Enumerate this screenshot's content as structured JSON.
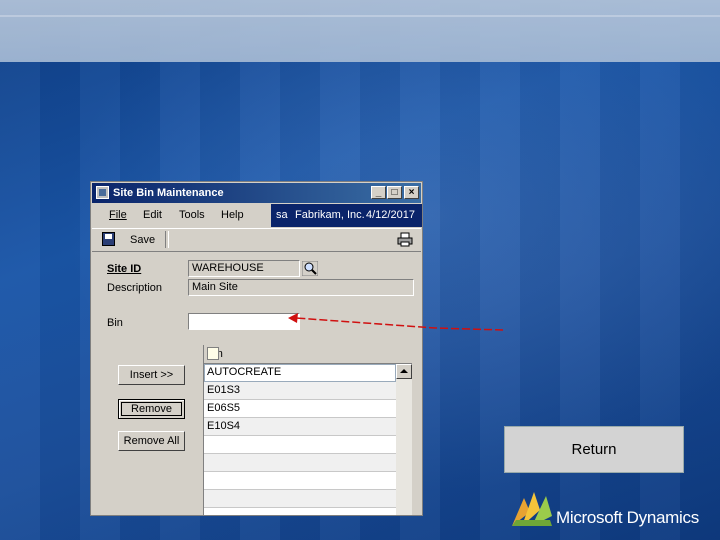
{
  "window": {
    "title": "Site Bin Maintenance",
    "controls": {
      "minimize": "_",
      "maximize": "□",
      "close": "×"
    }
  },
  "menu": [
    "File",
    "Edit",
    "Tools",
    "Help"
  ],
  "user_strip": {
    "user": "sa",
    "company": "Fabrikam, Inc.",
    "date": "4/12/2017"
  },
  "toolbar": {
    "save_label": "Save",
    "print_icon": "printer-icon"
  },
  "form": {
    "site_id_label": "Site ID",
    "site_id_value": "WAREHOUSE",
    "description_label": "Description",
    "description_value": "Main Site",
    "bin_label": "Bin",
    "bin_value": ""
  },
  "buttons": {
    "insert": "Insert >>",
    "remove": "Remove",
    "remove_all": "Remove All"
  },
  "grid": {
    "header": "Bin",
    "rows": [
      "AUTOCREATE",
      "E01S3",
      "E06S5",
      "E10S4",
      "",
      "",
      "",
      "",
      ""
    ]
  },
  "return_label": "Return",
  "brand": {
    "text": "Microsoft Dynamics",
    "accent": "#e7a232"
  },
  "colors": {
    "title_bar": "#0a246a",
    "dialog_bg": "#d4d0c8",
    "annotation_arrow": "#d01010"
  }
}
